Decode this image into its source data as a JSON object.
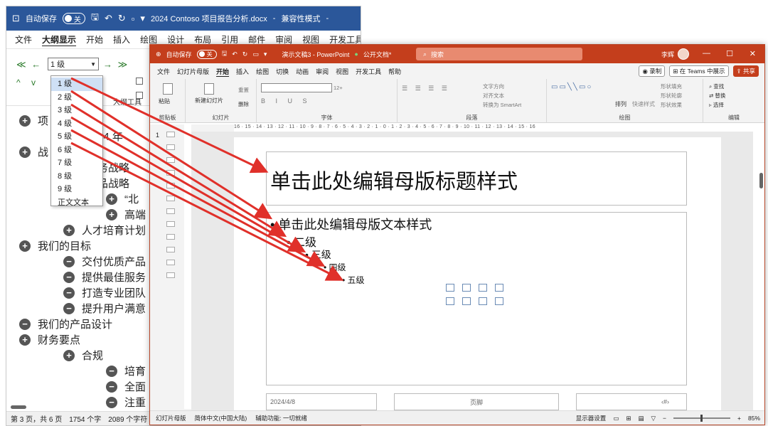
{
  "word": {
    "title": {
      "autosave": "自动保存",
      "toggle": "关",
      "filename": "2024 Contoso 项目报告分析.docx",
      "separator": "-",
      "mode": "兼容性模式",
      "trail": "-"
    },
    "menu": [
      "文件",
      "大纲显示",
      "开始",
      "插入",
      "绘图",
      "设计",
      "布局",
      "引用",
      "邮件",
      "审阅",
      "视图",
      "开发工具"
    ],
    "active_menu": "大纲显示",
    "level_value": "1 级",
    "outline_tools_label": "大纲工具",
    "level_options": [
      "1 级",
      "2 级",
      "3 级",
      "4 级",
      "5 级",
      "6 级",
      "7 级",
      "8 级",
      "9 级",
      "正文文本"
    ],
    "outline": [
      {
        "text": "项",
        "icon": "+"
      },
      {
        "text": "24 年",
        "icon": ""
      },
      {
        "text": "战",
        "icon": "+"
      },
      {
        "text": "务战略",
        "icon": ""
      },
      {
        "text": "品战略",
        "icon": ""
      },
      {
        "text": "“北",
        "icon": "+"
      },
      {
        "text": "高端",
        "icon": "+"
      },
      {
        "text": "人才培育计划",
        "icon": "+"
      },
      {
        "text": "我们的目标",
        "icon": "+"
      },
      {
        "text": "交付优质产品",
        "icon": "−"
      },
      {
        "text": "提供最佳服务",
        "icon": "−"
      },
      {
        "text": "打造专业团队",
        "icon": "−"
      },
      {
        "text": "提升用户满意",
        "icon": "−"
      },
      {
        "text": "我们的产品设计",
        "icon": "−"
      },
      {
        "text": "财务要点",
        "icon": "+"
      },
      {
        "text": "合规",
        "icon": "+"
      },
      {
        "text": "培育",
        "icon": "−"
      },
      {
        "text": "全面",
        "icon": "−"
      },
      {
        "text": "注重",
        "icon": "−"
      }
    ],
    "status": {
      "page": "第 3 页，共 6 页",
      "words": "1754 个字",
      "chars": "2089 个字符"
    }
  },
  "ppt": {
    "title": {
      "autosave": "自动保存",
      "toggle": "关",
      "filename": "演示文稿3 - PowerPoint",
      "label": "公开文档*",
      "search": "搜索",
      "user": "李辉"
    },
    "menu": [
      "文件",
      "幻灯片母版",
      "开始",
      "插入",
      "绘图",
      "切换",
      "动画",
      "审阅",
      "视图",
      "开发工具",
      "帮助"
    ],
    "active_menu": "开始",
    "record": "录制",
    "teams": "在 Teams 中展示",
    "share": "共享",
    "ribbon": {
      "clipboard": "剪贴板",
      "paste": "粘贴",
      "slides": "幻灯片",
      "new_slide": "新建幻灯片",
      "reset": "重置",
      "delete": "删除",
      "font": "字体",
      "font_size": "12+",
      "paragraph": "段落",
      "text_direction": "文字方向",
      "align_text": "对齐文本",
      "smartart": "转换为 SmartArt",
      "drawing": "绘图",
      "arrange": "排列",
      "quick_styles": "快速样式",
      "shape_fill": "形状填充",
      "shape_outline": "形状轮廓",
      "shape_effects": "形状效果",
      "editing": "编辑",
      "find": "查找",
      "replace": "替换",
      "select": "选择"
    },
    "ruler": "16 · 15 · 14 · 13 · 12 · 11 · 10 · 9 · 8 · 7 · 6 · 5 · 4 · 3 · 2 · 1 · 0 · 1 · 2 · 3 · 4 · 5 · 6 · 7 · 8 · 9 · 10 · 11 · 12 · 13 · 14 · 15 · 16",
    "slide_number": "1",
    "slide": {
      "title": "单击此处编辑母版标题样式",
      "levels": [
        "单击此处编辑母版文本样式",
        "二级",
        "三级",
        "四级",
        "五级"
      ],
      "date": "2024/4/8",
      "footer": "页脚",
      "page_num": "‹#›"
    },
    "status": {
      "view": "幻灯片母版",
      "language": "简体中文(中国大陆)",
      "accessibility": "辅助功能: 一切就绪",
      "display_settings": "显示器设置",
      "zoom": "85%"
    }
  },
  "colors": {
    "word_blue": "#2b579a",
    "ppt_red": "#c43e1c",
    "arrow_red": "#e0302a"
  }
}
